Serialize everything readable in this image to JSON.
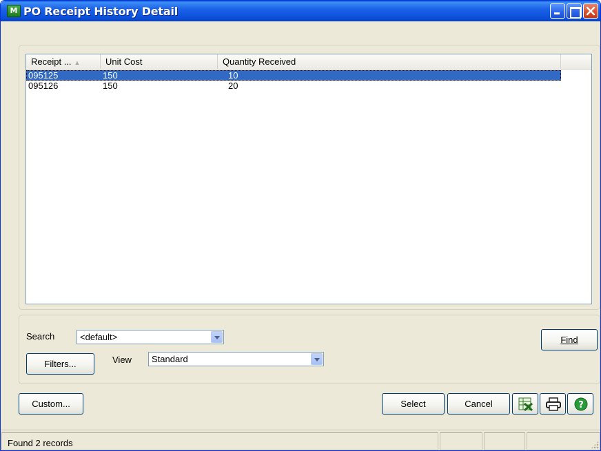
{
  "window": {
    "app_icon_text": "M",
    "title": "PO Receipt History Detail"
  },
  "list": {
    "columns": [
      "Receipt ...",
      "Unit Cost",
      "Quantity Received"
    ],
    "rows": [
      {
        "receipt": "095125",
        "unit_cost": "150",
        "quantity": "10",
        "selected": true
      },
      {
        "receipt": "095126",
        "unit_cost": "150",
        "quantity": "20",
        "selected": false
      }
    ]
  },
  "search": {
    "label": "Search",
    "value": "<default>"
  },
  "view": {
    "label": "View",
    "value": "Standard"
  },
  "buttons": {
    "find": "Find",
    "filters": "Filters...",
    "custom": "Custom...",
    "select": "Select",
    "cancel": "Cancel"
  },
  "icons": {
    "excel": "excel-icon",
    "print": "printer-icon",
    "help": "help-icon"
  },
  "status": {
    "text": "Found 2 records"
  },
  "colors": {
    "selection": "#316ac5",
    "titlebar": "#0b4fd8",
    "face": "#ece9d8"
  }
}
